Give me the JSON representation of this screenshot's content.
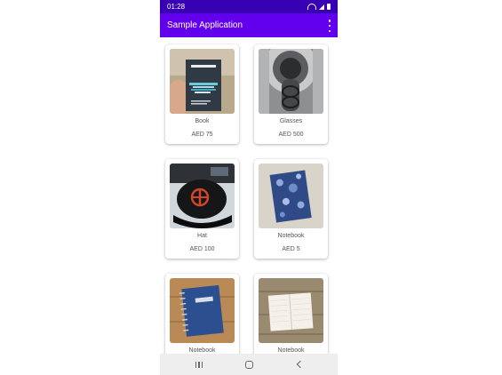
{
  "status_bar": {
    "time": "01:28",
    "icons": [
      "wifi-icon",
      "signal-icon",
      "battery-icon"
    ]
  },
  "app_bar": {
    "title": "Sample Application",
    "menu_icon": "overflow-menu-icon"
  },
  "theme": {
    "primary": "#6200ee",
    "primary_dark": "#3700b3"
  },
  "products": [
    {
      "name": "Book",
      "price": "AED 75",
      "image": "book-photo"
    },
    {
      "name": "Glasses",
      "price": "AED 500",
      "image": "glasses-photo"
    },
    {
      "name": "Hat",
      "price": "AED 100",
      "image": "hat-photo"
    },
    {
      "name": "Notebook",
      "price": "AED 5",
      "image": "notebook-blue-photo"
    },
    {
      "name": "Notebook",
      "price": "",
      "image": "notebook-spiral-photo"
    },
    {
      "name": "Notebook",
      "price": "",
      "image": "notebook-open-photo"
    }
  ],
  "nav_bar": {
    "buttons": [
      "recents-icon",
      "home-icon",
      "back-icon"
    ]
  }
}
